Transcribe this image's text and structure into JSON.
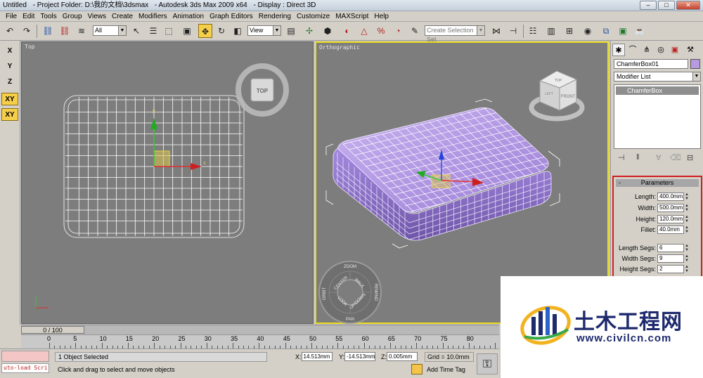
{
  "titlebar": {
    "doc": "Untitled",
    "project": "- Project Folder: D:\\我的文档\\3dsmax",
    "app": "- Autodesk 3ds Max  2009 x64",
    "display": "- Display : Direct 3D"
  },
  "window_buttons": {
    "minimize": "–",
    "maximize": "□",
    "close": "✕"
  },
  "menu": [
    "File",
    "Edit",
    "Tools",
    "Group",
    "Views",
    "Create",
    "Modifiers",
    "Animation",
    "Graph Editors",
    "Rendering",
    "Customize",
    "MAXScript",
    "Help"
  ],
  "toolbar": {
    "selection_filter": "All",
    "ref_coord": "View",
    "named_selection": "Create Selection Set"
  },
  "axis": {
    "x": "X",
    "y": "Y",
    "z": "Z",
    "xy": "XY",
    "xy2": "XY"
  },
  "viewports": {
    "top": {
      "label": "Top",
      "viewcube": "TOP"
    },
    "ortho": {
      "label": "Orthographic",
      "viewcube_top": "TOP",
      "viewcube_front": "FRONT",
      "viewcube_left": "LEFT"
    },
    "wheel": {
      "zoom": "ZOOM",
      "orbit": "ORBIT",
      "center": "CENTER",
      "walk": "WALK",
      "rewind": "REWIND",
      "look": "LOOK",
      "updown": "UP/DOWN",
      "pan": "PAN"
    }
  },
  "command_panel": {
    "object_name": "ChamferBox01",
    "object_color": "#b79adf",
    "modifier_list": "Modifier List",
    "stack_item": "ChamferBox",
    "rollout_title": "Parameters",
    "rollout_toggle": "-",
    "params": [
      {
        "label": "Length:",
        "value": "400.0mm"
      },
      {
        "label": "Width:",
        "value": "500.0mm"
      },
      {
        "label": "Height:",
        "value": "120.0mm"
      },
      {
        "label": "Fillet:",
        "value": "40.0mm"
      },
      {
        "label": "Length Segs:",
        "value": "6"
      },
      {
        "label": "Width Segs:",
        "value": "9"
      },
      {
        "label": "Height Segs:",
        "value": "2"
      }
    ]
  },
  "timeline": {
    "frame": "0 / 100",
    "ticks": [
      "0",
      "5",
      "10",
      "15",
      "20",
      "25",
      "30",
      "35",
      "40",
      "45",
      "50",
      "55",
      "60",
      "65",
      "70",
      "75",
      "80"
    ]
  },
  "status": {
    "maxscript": "uto-load Scri",
    "selection": "1 Object Selected",
    "prompt": "Click and drag to select and move objects",
    "x_label": "X:",
    "x": "14.513mm",
    "y_label": "Y:",
    "y": "-14.513mm",
    "z_label": "Z:",
    "z": "0.005mm",
    "grid": "Grid = 10.0mm",
    "add_time_tag": "Add Time Tag"
  },
  "watermark": {
    "name": "土木工程网",
    "url": "www.civilcn.com"
  },
  "colors": {
    "viewport_bg": "#7d7d7d",
    "active_border": "#e7d91b",
    "object": "#a98ce0",
    "highlight": "#f6cf4a"
  }
}
